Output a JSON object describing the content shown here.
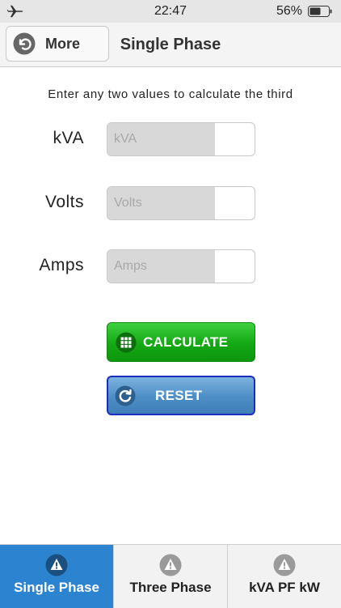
{
  "status_bar": {
    "time": "22:47",
    "battery_percent": "56%",
    "airplane_icon": "airplane-icon",
    "battery_icon": "battery-icon"
  },
  "nav": {
    "back_label": "More",
    "back_icon": "undo-arrow-icon",
    "title": "Single Phase"
  },
  "instruction": "Enter any two values to calculate the third",
  "fields": [
    {
      "label": "kVA",
      "placeholder": "kVA",
      "value": ""
    },
    {
      "label": "Volts",
      "placeholder": "Volts",
      "value": ""
    },
    {
      "label": "Amps",
      "placeholder": "Amps",
      "value": ""
    }
  ],
  "buttons": {
    "calculate_label": "CALCULATE",
    "calculate_icon": "keypad-icon",
    "reset_label": "RESET",
    "reset_icon": "refresh-icon"
  },
  "tabs": [
    {
      "label": "Single Phase",
      "icon": "warning-icon",
      "active": true
    },
    {
      "label": "Three Phase",
      "icon": "warning-icon",
      "active": false
    },
    {
      "label": "kVA PF kW",
      "icon": "warning-icon",
      "active": false
    }
  ],
  "colors": {
    "calculate": "#14a814",
    "reset": "#4d8ec6",
    "reset_border": "#1a2dbd",
    "active_tab": "#2c83d0"
  }
}
